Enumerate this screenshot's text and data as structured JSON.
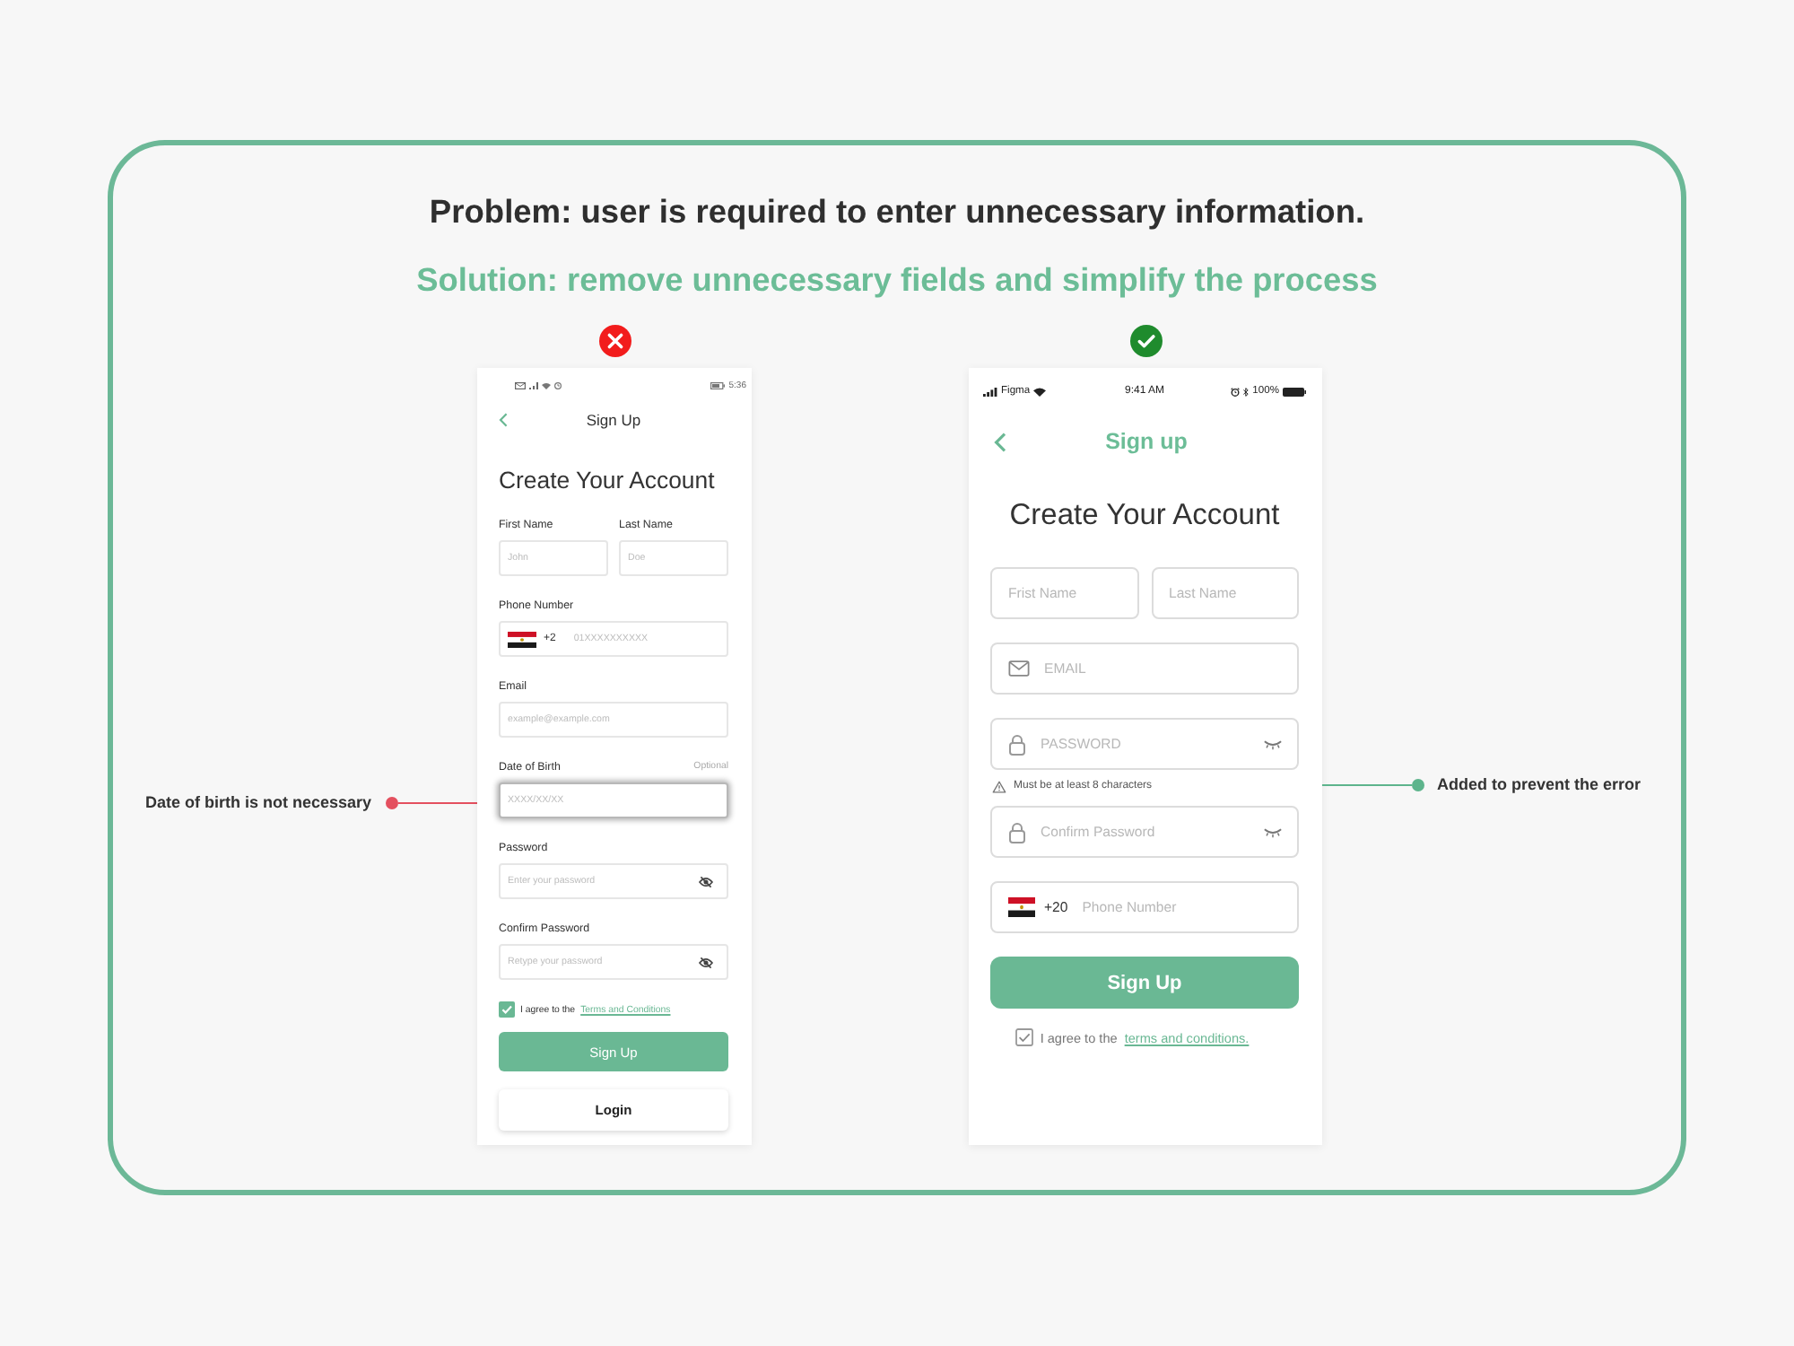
{
  "heading": {
    "problem": "Problem: user is required to enter unnecessary information.",
    "solution": "Solution: remove unnecessary fields and simplify the process"
  },
  "annotations": [
    {
      "text": "Date of birth is not necessary",
      "color": "#e4505f"
    },
    {
      "text": "Added to prevent the error",
      "color": "#5db48c"
    }
  ],
  "left_screen": {
    "approved": false,
    "status_bar": {
      "time": "5:36"
    },
    "title": "Sign Up",
    "heading": "Create Your Account",
    "rows": [
      [
        {
          "kind": "text",
          "label": "First Name",
          "placeholder": "John",
          "highlighted": false
        },
        {
          "kind": "text",
          "label": "Last Name",
          "placeholder": "Doe",
          "highlighted": false
        }
      ],
      [
        {
          "kind": "phone",
          "label": "Phone Number",
          "prefix": "+2",
          "placeholder": "01XXXXXXXXXX",
          "highlighted": false
        }
      ],
      [
        {
          "kind": "text",
          "label": "Email",
          "placeholder": "example@example.com",
          "highlighted": false
        }
      ],
      [
        {
          "kind": "text",
          "label": "Date of Birth",
          "hint": "Optional",
          "placeholder": "XXXX/XX/XX",
          "highlighted": true
        }
      ],
      [
        {
          "kind": "password",
          "label": "Password",
          "placeholder": "Enter your password",
          "highlighted": false
        }
      ],
      [
        {
          "kind": "password",
          "label": "Confirm Password",
          "placeholder": "Retype your password",
          "highlighted": false
        }
      ]
    ],
    "agreement": {
      "checked": true,
      "text": "I agree to the",
      "link": "Terms and Conditions"
    },
    "buttons": [
      {
        "kind": "primary",
        "label": "Sign Up"
      },
      {
        "kind": "secondary",
        "label": "Login"
      }
    ]
  },
  "right_screen": {
    "approved": true,
    "status_bar": {
      "carrier": "Figma",
      "time": "9:41 AM",
      "battery": "100%"
    },
    "title": "Sign up",
    "heading": "Create Your Account",
    "rows": [
      [
        {
          "kind": "text",
          "placeholder": "Frist Name"
        },
        {
          "kind": "text",
          "placeholder": "Last Name"
        }
      ],
      [
        {
          "kind": "email",
          "placeholder": "EMAIL"
        }
      ],
      [
        {
          "kind": "password",
          "placeholder": "PASSWORD",
          "note": "Must be at least 8 characters"
        }
      ],
      [
        {
          "kind": "password",
          "placeholder": "Confirm Password"
        }
      ],
      [
        {
          "kind": "phone",
          "prefix": "+20",
          "placeholder": "Phone Number"
        }
      ]
    ],
    "buttons": [
      {
        "kind": "primary",
        "label": "Sign Up"
      }
    ],
    "agreement": {
      "checked": true,
      "text": "I agree to the",
      "link": "terms and conditions."
    }
  }
}
